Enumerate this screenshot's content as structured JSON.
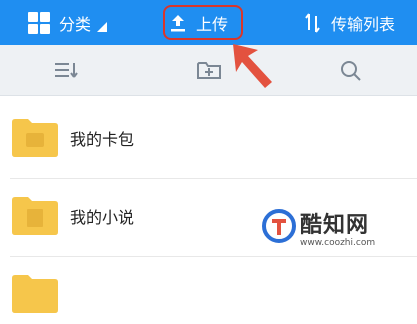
{
  "topbar": {
    "category_label": "分类",
    "upload_label": "上传",
    "transfer_label": "传输列表"
  },
  "toolbar": {
    "sort_icon": "sort-list-icon",
    "new_folder_icon": "add-folder-icon",
    "search_icon": "search-icon"
  },
  "files": [
    {
      "name": "我的卡包",
      "icon": "folder-icon"
    },
    {
      "name": "我的小说",
      "icon": "folder-icon"
    },
    {
      "name": "",
      "icon": "folder-icon"
    }
  ],
  "watermark": {
    "title": "酷知网",
    "url": "www.coozhi.com"
  },
  "colors": {
    "accent": "#1f8ef1",
    "highlight": "#d9362b",
    "folder": "#f6c64b"
  }
}
